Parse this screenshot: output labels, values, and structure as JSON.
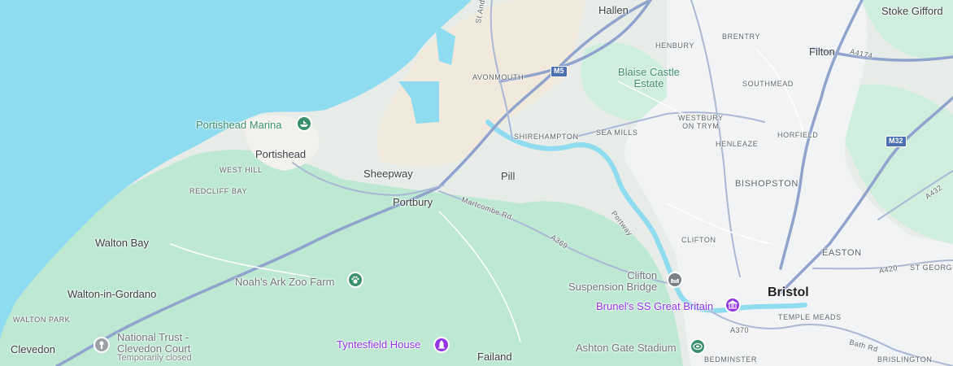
{
  "map": {
    "colors": {
      "water": "#8fdcf0",
      "land": "#e8ece9",
      "park": "#bde9d2",
      "urban": "#f1f3f4",
      "industrial": "#f0e9dc",
      "motorway": "#8fa3cc",
      "road": "#ffffff",
      "poi_green": "#3a8f6e",
      "poi_purple": "#9334e6",
      "poi_grey": "#9aa0a6"
    },
    "places": {
      "hallen": "Hallen",
      "stoke_gifford": "Stoke Gifford",
      "filton": "Filton",
      "henbury": "HENBURY",
      "brentry": "BRENTRY",
      "avonmouth": "AVONMOUTH",
      "southmead": "SOUTHMEAD",
      "westbury": "WESTBURY\nON TRYM",
      "shirehampton": "SHIREHAMPTON",
      "sea_mills": "SEA MILLS",
      "henleaze": "HENLEAZE",
      "horfield": "HORFIELD",
      "portishead": "Portishead",
      "west_hill": "WEST HILL",
      "sheepway": "Sheepway",
      "pill": "Pill",
      "redcliff_bay": "REDCLIFF BAY",
      "portbury": "Portbury",
      "bishopston": "BISHOPSTON",
      "walton_bay": "Walton Bay",
      "clifton": "CLIFTON",
      "easton": "EASTON",
      "st_george": "ST GEORGE",
      "bristol": "Bristol",
      "walton_in_gordano": "Walton-in-Gordano",
      "temple_meads": "TEMPLE MEADS",
      "walton_park": "WALTON PARK",
      "clevedon": "Clevedon",
      "failand": "Failand",
      "bedminster": "BEDMINSTER",
      "brislington": "BRISLINGTON"
    },
    "pois": {
      "portishead_marina": {
        "label": "Portishead Marina",
        "icon": "boat-icon"
      },
      "blaise_castle": {
        "label": "Blaise Castle\nEstate"
      },
      "noahs_ark": {
        "label": "Noah's Ark Zoo Farm",
        "icon": "paw-icon"
      },
      "clifton_bridge": {
        "label": "Clifton\nSuspension Bridge",
        "icon": "bridge-icon"
      },
      "ss_great_britain": {
        "label": "Brunel's SS Great Britain",
        "icon": "museum-icon"
      },
      "national_trust": {
        "label": "National Trust -\nClevedon Court",
        "status": "Temporarily closed",
        "icon": "national-trust-icon"
      },
      "tyntesfield": {
        "label": "Tyntesfield House",
        "icon": "landmark-icon"
      },
      "ashton_gate": {
        "label": "Ashton Gate Stadium",
        "icon": "stadium-icon"
      }
    },
    "roads": {
      "st_andrews_rd": "St Andrews Rd",
      "a4174": "A4174",
      "m5": "M5",
      "m32": "M32",
      "portway": "Portway",
      "martcombe_rd": "Martcombe Rd",
      "a369": "A369",
      "a420": "A420",
      "a370": "A370",
      "bath_rd": "Bath Rd",
      "a432": "A432"
    }
  }
}
